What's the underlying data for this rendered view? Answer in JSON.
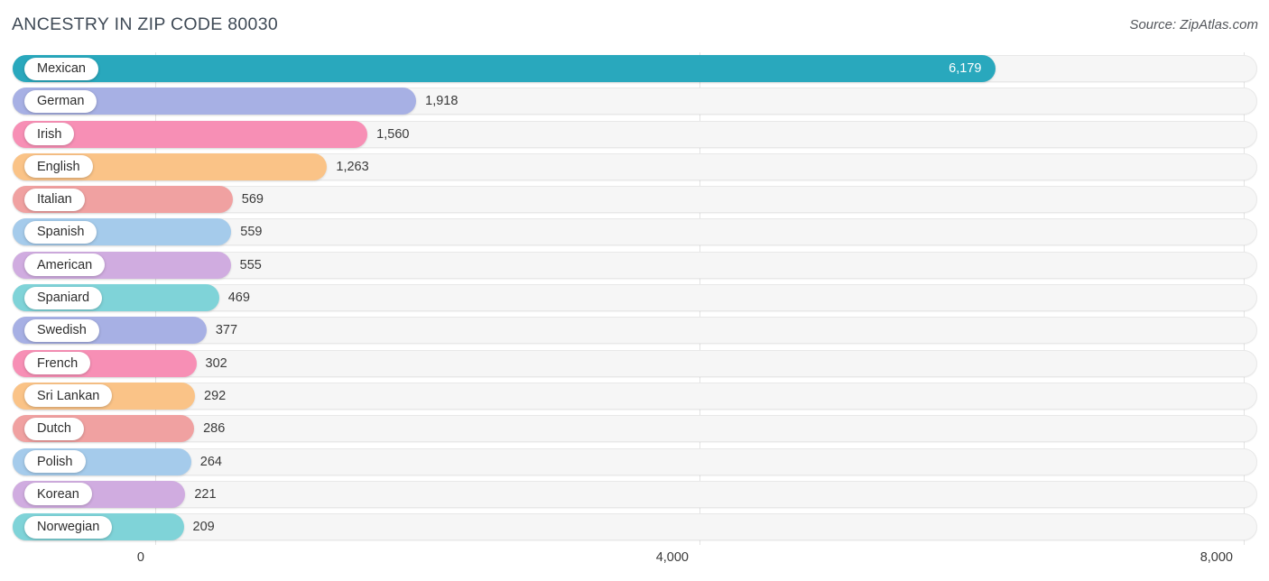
{
  "header": {
    "title": "ANCESTRY IN ZIP CODE 80030",
    "source": "Source: ZipAtlas.com"
  },
  "axis": {
    "ticks": [
      "0",
      "4,000",
      "8,000"
    ],
    "tick_values": [
      0,
      4000,
      8000
    ]
  },
  "chart_data": {
    "type": "bar",
    "orientation": "horizontal",
    "title": "ANCESTRY IN ZIP CODE 80030",
    "xlabel": "",
    "ylabel": "",
    "xlim": [
      0,
      8000
    ],
    "grid": true,
    "legend": false,
    "categories": [
      "Mexican",
      "German",
      "Irish",
      "English",
      "Italian",
      "Spanish",
      "American",
      "Spaniard",
      "Swedish",
      "French",
      "Sri Lankan",
      "Dutch",
      "Polish",
      "Korean",
      "Norwegian"
    ],
    "values": [
      6179,
      1918,
      1560,
      1263,
      569,
      559,
      555,
      469,
      377,
      302,
      292,
      286,
      264,
      221,
      209
    ],
    "value_labels": [
      "6,179",
      "1,918",
      "1,560",
      "1,263",
      "569",
      "559",
      "555",
      "469",
      "377",
      "302",
      "292",
      "286",
      "264",
      "221",
      "209"
    ],
    "colors": [
      "#29a8bd",
      "#a7b0e4",
      "#f78fb5",
      "#fac387",
      "#f0a1a1",
      "#a5cbeb",
      "#d0ace0",
      "#7fd3d8",
      "#a7b0e4",
      "#f78fb5",
      "#fac387",
      "#f0a1a1",
      "#a5cbeb",
      "#d0ace0",
      "#7fd3d8"
    ],
    "label_inside": [
      true,
      false,
      false,
      false,
      false,
      false,
      false,
      false,
      false,
      false,
      false,
      false,
      false,
      false,
      false
    ]
  },
  "palette": {
    "teal": "#29a8bd",
    "periwinkle": "#a7b0e4",
    "pink": "#f78fb5",
    "orange": "#fac387",
    "salmon": "#f0a1a1",
    "lightblue": "#a5cbeb",
    "mauve": "#d0ace0",
    "turquoise": "#7fd3d8",
    "track": "#f6f6f6",
    "gridline": "#e3e3e3"
  }
}
